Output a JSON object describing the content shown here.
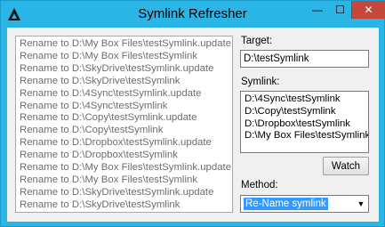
{
  "window": {
    "title": "Symlink Refresher",
    "accent_color": "#29b5e5",
    "minimize_glyph": "—",
    "maximize_glyph": "☐",
    "close_glyph": "✕"
  },
  "log": {
    "lines": [
      "Rename to D:\\My Box Files\\testSymlink.update",
      "Rename to D:\\My Box Files\\testSymlink",
      "Rename to D:\\SkyDrive\\testSymlink.update",
      "Rename to D:\\SkyDrive\\testSymlink",
      "Rename to D:\\4Sync\\testSymlink.update",
      "Rename to D:\\4Sync\\testSymlink",
      "Rename to D:\\Copy\\testSymlink.update",
      "Rename to D:\\Copy\\testSymlink",
      "Rename to D:\\Dropbox\\testSymlink.update",
      "Rename to D:\\Dropbox\\testSymlink",
      "Rename to D:\\My Box Files\\testSymlink.update",
      "Rename to D:\\My Box Files\\testSymlink",
      "Rename to D:\\SkyDrive\\testSymlink.update",
      "Rename to D:\\SkyDrive\\testSymlink"
    ]
  },
  "target": {
    "label": "Target:",
    "value": "D:\\testSymlink"
  },
  "symlink": {
    "label": "Symlink:",
    "items": [
      "D:\\4Sync\\testSymlink",
      "D:\\Copy\\testSymlink",
      "D:\\Dropbox\\testSymlink",
      "D:\\My Box Files\\testSymlink"
    ]
  },
  "watch_button": {
    "label": "Watch"
  },
  "method": {
    "label": "Method:",
    "selected": "Re-Name symlink",
    "arrow_glyph": "▼"
  }
}
